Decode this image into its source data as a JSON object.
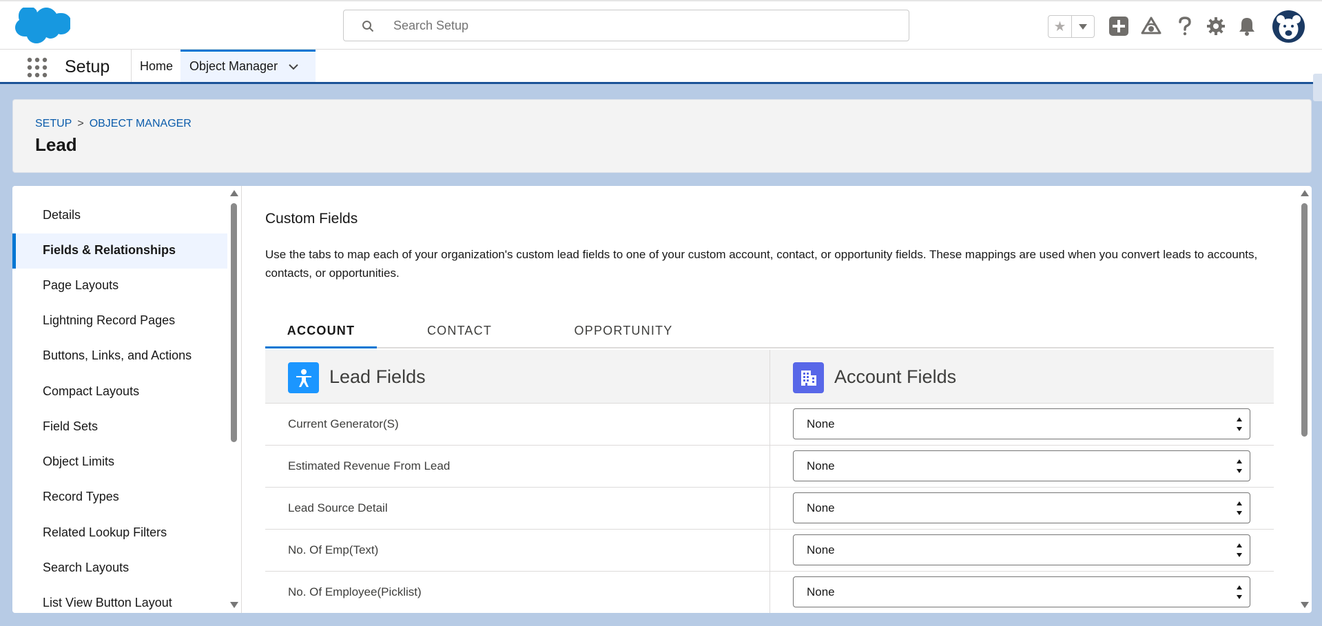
{
  "header": {
    "search_placeholder": "Search Setup",
    "icons": [
      "cloud-logo-icon",
      "search-icon",
      "favorites-star-icon",
      "favorites-menu-icon",
      "global-actions-icon",
      "trailhead-icon",
      "help-icon",
      "gear-icon",
      "notifications-bell-icon",
      "avatar"
    ]
  },
  "nav": {
    "app_name": "Setup",
    "tabs": [
      {
        "label": "Home"
      },
      {
        "label": "Object Manager",
        "selected": true
      }
    ]
  },
  "page_header": {
    "breadcrumb": [
      "SETUP",
      ">",
      "OBJECT MANAGER"
    ],
    "title": "Lead"
  },
  "sidebar": {
    "items": [
      {
        "label": "Details"
      },
      {
        "label": "Fields & Relationships",
        "selected": true
      },
      {
        "label": "Page Layouts"
      },
      {
        "label": "Lightning Record Pages"
      },
      {
        "label": "Buttons, Links, and Actions"
      },
      {
        "label": "Compact Layouts"
      },
      {
        "label": "Field Sets"
      },
      {
        "label": "Object Limits"
      },
      {
        "label": "Record Types"
      },
      {
        "label": "Related Lookup Filters"
      },
      {
        "label": "Search Layouts"
      },
      {
        "label": "List View Button Layout"
      }
    ]
  },
  "main": {
    "section_title": "Custom Fields",
    "description": "Use the tabs to map each of your organization's custom lead fields to one of your custom account, contact, or opportunity fields. These mappings are used when you convert leads to accounts, contacts, or opportunities.",
    "tabs": [
      {
        "label": "ACCOUNT",
        "selected": true
      },
      {
        "label": "CONTACT"
      },
      {
        "label": "OPPORTUNITY"
      }
    ],
    "table": {
      "left_header": "Lead Fields",
      "right_header": "Account Fields",
      "rows": [
        {
          "field": "Current Generator(S)",
          "mapping": "None"
        },
        {
          "field": "Estimated Revenue From Lead",
          "mapping": "None"
        },
        {
          "field": "Lead Source Detail",
          "mapping": "None"
        },
        {
          "field": "No. Of Emp(Text)",
          "mapping": "None"
        },
        {
          "field": "No. Of Employee(Picklist)",
          "mapping": "None"
        }
      ]
    }
  },
  "colors": {
    "brand_blue": "#0176d3",
    "cloud_blue": "#1798e0",
    "lead_icon_bg": "#1b96ff",
    "account_icon_bg": "#5867e8",
    "link_blue": "#0b5cab"
  }
}
